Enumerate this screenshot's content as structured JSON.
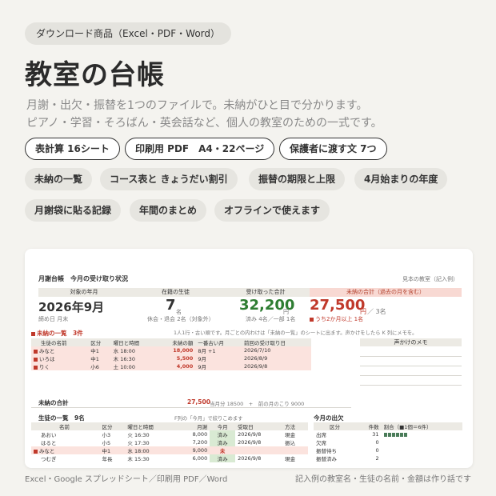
{
  "tag": "ダウンロード商品（Excel・PDF・Word）",
  "title": "教室の台帳",
  "desc": [
    "月謝・出欠・振替を1つのファイルで。未納がひと目で分かります。",
    "ピアノ・学習・そろばん・英会話など、個人の教室のための一式です。"
  ],
  "pills_outline": [
    "表計算 16シート",
    "印刷用 PDF　A4・22ページ",
    "保護者に渡す文 7つ"
  ],
  "pills_fill": [
    "未納の一覧",
    "コース表と きょうだい割引",
    "振替の期限と上限",
    "4月始まりの年度",
    "月謝袋に貼る記録",
    "年間のまとめ",
    "オフラインで使えます"
  ],
  "sheet": {
    "title": "月謝台帳　今月の受け取り状況",
    "sample": "見本の教室（記入例）",
    "kpi_labels": [
      "対象の年月",
      "在籍の生徒",
      "受け取った合計",
      "未納の合計（過去の月を含む）"
    ],
    "kpi_month": "2026年9月",
    "kpi_month_sub": "締め日 月末",
    "kpi_students": "7",
    "kpi_students_unit": "名",
    "kpi_students_sub": "休会・退会 2名（対象外）",
    "kpi_received": "32,200",
    "kpi_received_unit": "円",
    "kpi_received_sub": "済み 4名／一部 1名",
    "kpi_unpaid": "27,500",
    "kpi_unpaid_unit": "円",
    "kpi_unpaid_count": "／ 3名",
    "kpi_unpaid_sub": "うち2か月以上 1名",
    "unpaid_title": "未納の一覧　3件",
    "unpaid_note": "1人1行・古い順です。月ごとの内わけは「未納の一覧」のシートに出ます。声かけをしたら K 列にメモを。",
    "unpaid_headers": [
      "生徒の名前",
      "区分",
      "曜日と時間",
      "未納の額",
      "一番古い月",
      "前回の受け取り日"
    ],
    "unpaid_rows": [
      [
        "みなと",
        "中1",
        "水 18:00",
        "18,000",
        "8月 +1",
        "2026/7/10"
      ],
      [
        "いろは",
        "中1",
        "木 16:30",
        "5,500",
        "9月",
        "2026/8/9"
      ],
      [
        "りく",
        "小6",
        "土 10:00",
        "4,000",
        "9月",
        "2026/9/8"
      ]
    ],
    "memo_title": "声かけのメモ",
    "total_label": "未納の合計",
    "total_value": "27,500",
    "total_detail": "当月分 18500　+　前の月のこり 9000",
    "students_title": "生徒の一覧　9名",
    "students_note": "F列の「今月」で絞りこめます",
    "students_headers": [
      "名前",
      "区分",
      "曜日と時間",
      "月謝",
      "今月",
      "受取日",
      "方法"
    ],
    "students_rows": [
      [
        "あおい",
        "小3",
        "火 16:30",
        "8,000",
        "済み",
        "2026/9/8",
        "現金"
      ],
      [
        "はると",
        "小5",
        "火 17:30",
        "7,200",
        "済み",
        "2026/9/8",
        "振込"
      ],
      [
        "みなと",
        "中1",
        "水 18:00",
        "9,000",
        "未",
        "",
        ""
      ],
      [
        "つむぎ",
        "年長",
        "木 15:30",
        "6,000",
        "済み",
        "2026/9/8",
        "現金"
      ]
    ],
    "att_title": "今月の出欠",
    "att_headers": [
      "区分",
      "件数",
      "割合（■1個＝6件）"
    ],
    "att_rows": [
      [
        "出席",
        "31"
      ],
      [
        "欠席",
        "0"
      ],
      [
        "振替待ち",
        "0"
      ],
      [
        "振替済み",
        "2"
      ]
    ]
  },
  "footer_left": "Excel・Google スプレッドシート／印刷用 PDF／Word",
  "footer_right": "記入例の教室名・生徒の名前・金額は作り話です"
}
